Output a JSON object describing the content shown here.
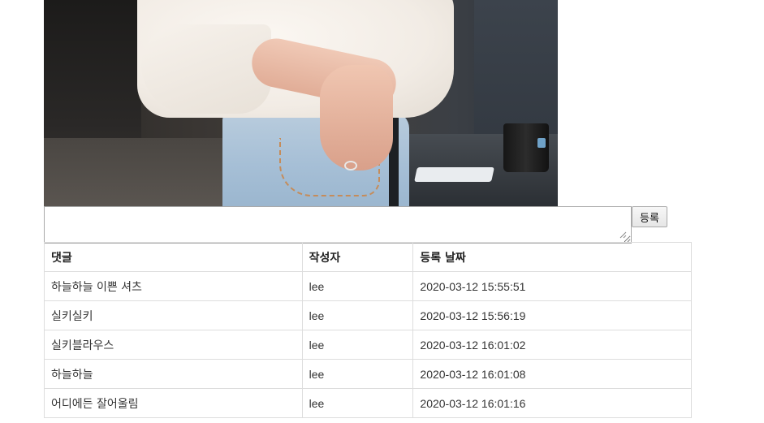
{
  "form": {
    "comment_placeholder": "",
    "comment_value": "",
    "submit_label": "등록"
  },
  "table": {
    "headers": {
      "comment": "댓글",
      "author": "작성자",
      "date": "등록 날짜"
    },
    "rows": [
      {
        "comment": "하늘하늘 이쁜 셔츠",
        "author": "lee",
        "date": "2020-03-12 15:55:51"
      },
      {
        "comment": "실키실키",
        "author": "lee",
        "date": "2020-03-12 15:56:19"
      },
      {
        "comment": "실키블라우스",
        "author": "lee",
        "date": "2020-03-12 16:01:02"
      },
      {
        "comment": "하늘하늘",
        "author": "lee",
        "date": "2020-03-12 16:01:08"
      },
      {
        "comment": "어디에든 잘어울림",
        "author": "lee",
        "date": "2020-03-12 16:01:16"
      }
    ]
  }
}
